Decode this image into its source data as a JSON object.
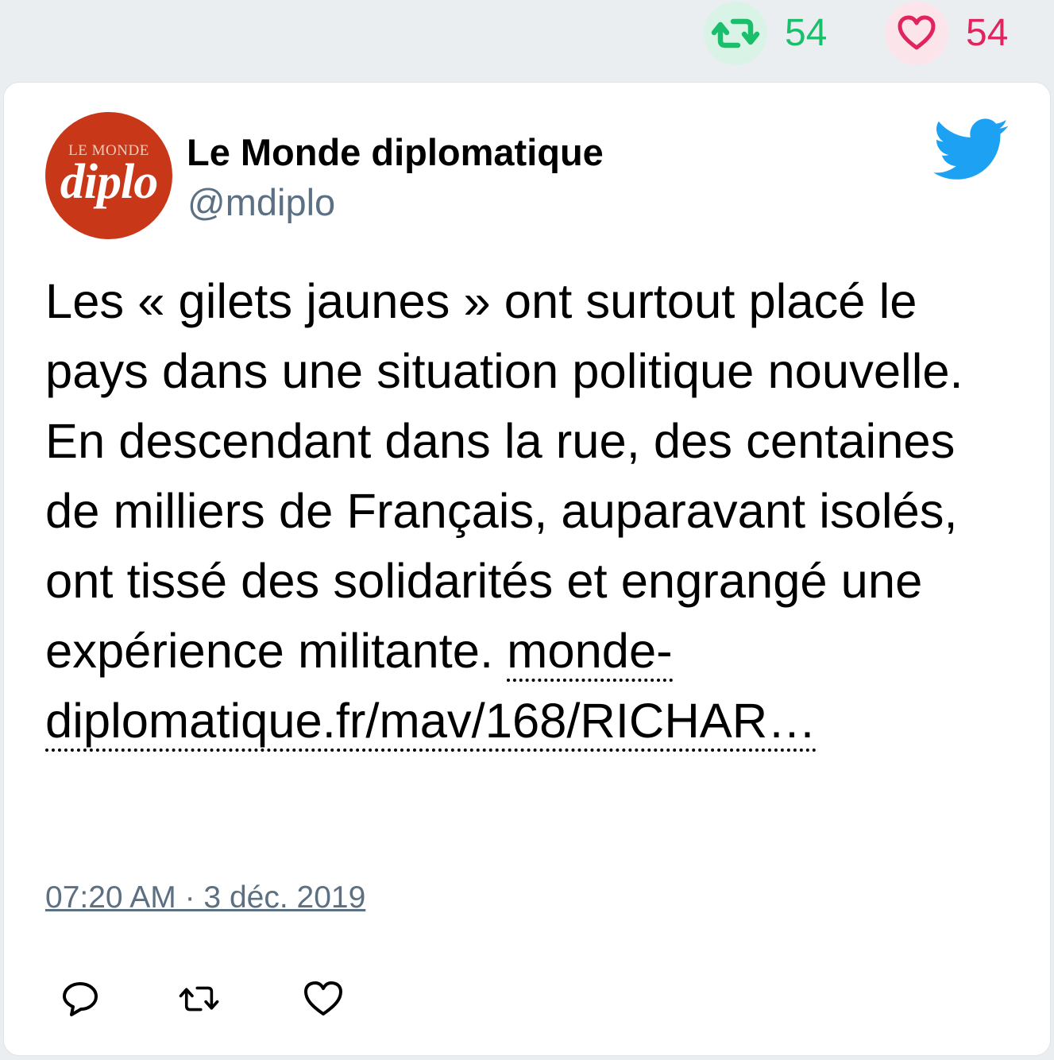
{
  "stats": {
    "retweet_count": "54",
    "like_count": "54"
  },
  "tweet": {
    "avatar_text_top": "LE MONDE",
    "avatar_text_main": "diplo",
    "display_name": "Le Monde diplomatique",
    "handle": "@mdiplo",
    "body": "Les « gilets jaunes » ont surtout placé le pays dans une situation politique nouvelle. En descendant dans la rue, des centaines de milliers de Français, auparavant isolés, ont tissé des solidarités et engrangé une expérience militante. ",
    "link_text": "monde-diplomatique.fr/mav/168/RICHAR…",
    "timestamp": "07:20 AM · 3 déc. 2019"
  },
  "icons": {
    "stat_retweet": "retweet-icon",
    "stat_like": "heart-icon",
    "brand": "twitter-bird-icon",
    "reply": "reply-icon",
    "retweet": "retweet-icon",
    "like": "heart-icon"
  },
  "colors": {
    "retweet_green": "#19bf6b",
    "like_red": "#e0245e",
    "twitter_blue": "#1da1f2",
    "secondary_text": "#5b7083",
    "avatar_red": "#c93719"
  }
}
